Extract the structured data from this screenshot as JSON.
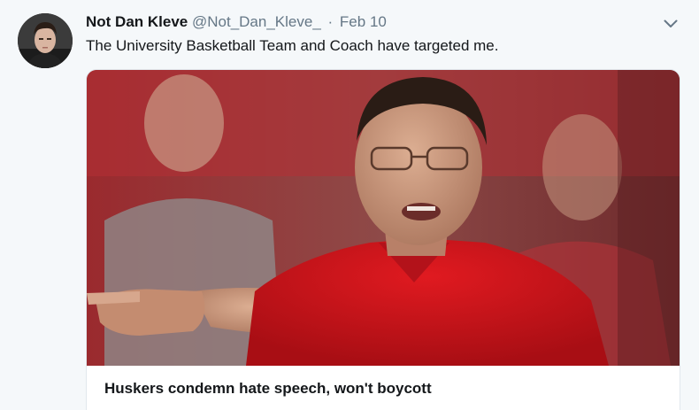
{
  "author": {
    "display_name": "Not Dan Kleve",
    "handle": "@Not_Dan_Kleve_",
    "separator": "·",
    "date": "Feb 10"
  },
  "tweet": {
    "text": "The University Basketball Team and Coach have targeted me."
  },
  "card": {
    "title": "Huskers condemn hate speech, won't boycott"
  },
  "icons": {
    "menu": "chevron-down-icon"
  },
  "colors": {
    "name": "#14171a",
    "meta": "#657786",
    "background": "#f5f8fa",
    "card_border": "#e1e8ed",
    "shirt_red": "#d1131a"
  }
}
